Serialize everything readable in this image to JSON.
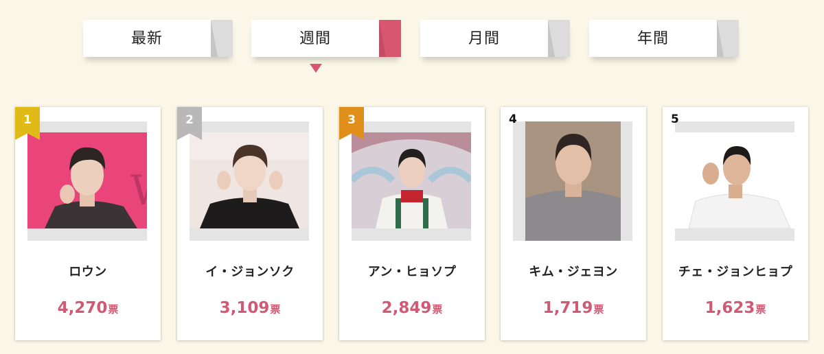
{
  "tabs": [
    {
      "label": "最新"
    },
    {
      "label": "週間",
      "active": true
    },
    {
      "label": "月間"
    },
    {
      "label": "年間"
    }
  ],
  "colors": {
    "background": "#fbf7e8",
    "accent": "#d8566f",
    "vote_text": "#d05a73",
    "rank_gold": "#e0bb17",
    "rank_silver": "#b8b8b8",
    "rank_bronze": "#df8f1a"
  },
  "ranking": [
    {
      "rank": "1",
      "name": "ロウン",
      "votes": "4,270",
      "unit": "票"
    },
    {
      "rank": "2",
      "name": "イ・ジョンソク",
      "votes": "3,109",
      "unit": "票"
    },
    {
      "rank": "3",
      "name": "アン・ヒョソプ",
      "votes": "2,849",
      "unit": "票"
    },
    {
      "rank": "4",
      "name": "キム・ジェヨン",
      "votes": "1,719",
      "unit": "票"
    },
    {
      "rank": "5",
      "name": "チェ・ジョンヒョプ",
      "votes": "1,623",
      "unit": "票"
    }
  ]
}
